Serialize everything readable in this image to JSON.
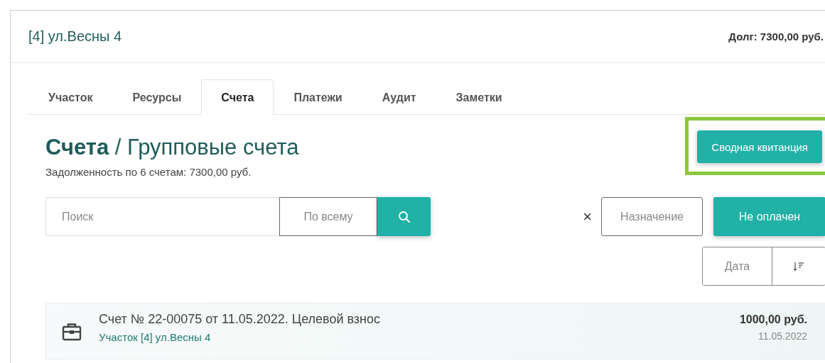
{
  "header": {
    "title": "[4] ул.Весны 4",
    "debt": "Долг: 7300,00 руб."
  },
  "tabs": [
    {
      "label": "Участок",
      "selected": false
    },
    {
      "label": "Ресурсы",
      "selected": false
    },
    {
      "label": "Счета",
      "selected": true
    },
    {
      "label": "Платежи",
      "selected": false
    },
    {
      "label": "Аудит",
      "selected": false
    },
    {
      "label": "Заметки",
      "selected": false
    }
  ],
  "page": {
    "title": "Счета",
    "subtitle_sep": "/",
    "subtitle": "Групповые счета",
    "summary": "Задолженность по 6 счетам: 7300,00 руб."
  },
  "summary_button": {
    "label": "Сводная квитанция",
    "highlighted": true
  },
  "search": {
    "placeholder": "Поиск",
    "scope": "По всему"
  },
  "filters": {
    "clear": "×",
    "purpose": "Назначение",
    "status": "Не оплачен"
  },
  "sort": {
    "field": "Дата"
  },
  "invoices": [
    {
      "title": "Счет № 22-00075 от 11.05.2022. Целевой взнос",
      "plot": "Участок [4] ул.Весны 4",
      "amount": "1000,00 руб.",
      "date": "11.05.2022"
    }
  ]
}
